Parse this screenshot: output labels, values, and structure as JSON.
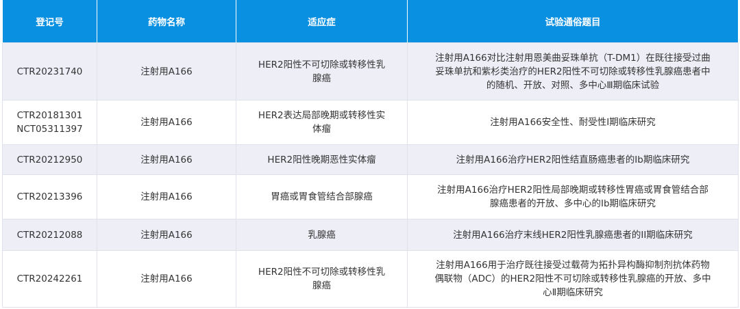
{
  "headers": {
    "reg_no": "登记号",
    "drug_name": "药物名称",
    "indication": "适应症",
    "trial_title": "试验通俗题目"
  },
  "rows": [
    {
      "reg_no": [
        "CTR20231740"
      ],
      "drug": "注射用A166",
      "indication": [
        "HER2阳性不可切除或转移性乳",
        "腺癌"
      ],
      "title": [
        "注射用A166对比注射用恩美曲妥珠单抗（T-DM1）在既往接受过曲",
        "妥珠单抗和紫杉类治疗的HER2阳性不可切除或转移性乳腺癌患者中",
        "的随机、开放、对照、多中心Ⅲ期临床试验"
      ]
    },
    {
      "reg_no": [
        "CTR20181301",
        "NCT05311397"
      ],
      "drug": "注射用A166",
      "indication": [
        "HER2表达局部晚期或转移性实",
        "体瘤"
      ],
      "title": [
        "注射用A166安全性、耐受性Ⅰ期临床研究"
      ]
    },
    {
      "reg_no": [
        "CTR20212950"
      ],
      "drug": "注射用A166",
      "indication": [
        "HER2阳性晚期恶性实体瘤"
      ],
      "title": [
        "注射用A166治疗HER2阳性结直肠癌患者的Ⅰb期临床研究"
      ]
    },
    {
      "reg_no": [
        "CTR20213396"
      ],
      "drug": "注射用A166",
      "indication": [
        "胃癌或胃食管结合部腺癌"
      ],
      "title": [
        "注射用A166治疗HER2阳性局部晚期或转移性胃癌或胃食管结合部",
        "腺癌患者的开放、多中心的Ⅰb期临床研究"
      ]
    },
    {
      "reg_no": [
        "CTR20212088"
      ],
      "drug": "注射用A166",
      "indication": [
        "乳腺癌"
      ],
      "title": [
        "注射用A166治疗末线HER2阳性乳腺癌患者的II期临床研究"
      ]
    },
    {
      "reg_no": [
        "CTR20242261"
      ],
      "drug": "注射用A166",
      "indication": [
        "HER2阳性不可切除或转移性乳",
        "腺癌"
      ],
      "title": [
        "注射用A166用于治疗既往接受过载荷为拓扑异构酶抑制剂抗体药物",
        "偶联物（ADC）的HER2阳性不可切除或转移性乳腺癌的开放、多中",
        "心Ⅱ期临床研究"
      ]
    }
  ],
  "colors": {
    "header_bg": "#0a90e0",
    "header_text": "#ffffff",
    "stripe_bg": "#eeeef7",
    "row_bg": "#ffffff",
    "border": "#dfe2ea"
  }
}
